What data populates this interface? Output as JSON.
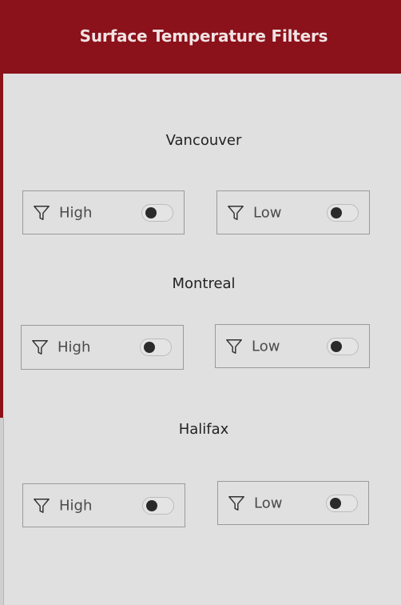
{
  "header": {
    "title": "Surface Temperature Filters"
  },
  "colors": {
    "header_bg": "#8b111a",
    "header_text": "#f1e3e3",
    "page_bg": "#e0e0e0"
  },
  "cities": [
    {
      "name": "Vancouver",
      "filters": [
        {
          "label": "High",
          "icon": "filter-icon",
          "on": false
        },
        {
          "label": "Low",
          "icon": "filter-icon",
          "on": false
        }
      ]
    },
    {
      "name": "Montreal",
      "filters": [
        {
          "label": "High",
          "icon": "filter-icon",
          "on": false
        },
        {
          "label": "Low",
          "icon": "filter-icon",
          "on": false
        }
      ]
    },
    {
      "name": "Halifax",
      "filters": [
        {
          "label": "High",
          "icon": "filter-icon",
          "on": false
        },
        {
          "label": "Low",
          "icon": "filter-icon",
          "on": false
        }
      ]
    }
  ]
}
